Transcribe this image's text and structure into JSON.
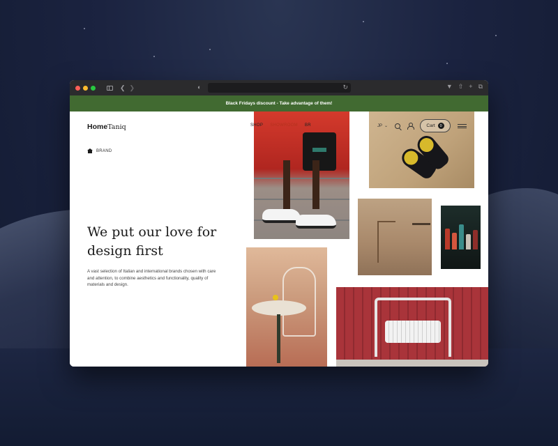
{
  "browser": {
    "url": ""
  },
  "banner": {
    "text": "Black Fridays discount - Take advantage of them!",
    "color": "#416a31"
  },
  "header": {
    "logo_bold": "Home",
    "logo_light": "Taniq",
    "nav": [
      {
        "label": "SHOP"
      },
      {
        "label": "SHOWROOM"
      },
      {
        "label": "BR"
      }
    ],
    "language": "JP",
    "cart_label": "Cart",
    "cart_count": "0"
  },
  "breadcrumb": {
    "label": "BRAND"
  },
  "hero": {
    "headline": "We put our love for design first",
    "description": "A vast selection of Italian and international brands chosen with care and attention, to combine aesthetics and functionality, quality of materials and design."
  },
  "icons": [
    "sidebar-icon",
    "back-icon",
    "forward-icon",
    "shield-icon",
    "reload-icon",
    "download-icon",
    "share-icon",
    "new-tab-icon",
    "tabs-icon",
    "home-icon",
    "chevron-down-icon",
    "search-icon",
    "user-icon",
    "menu-icon"
  ]
}
